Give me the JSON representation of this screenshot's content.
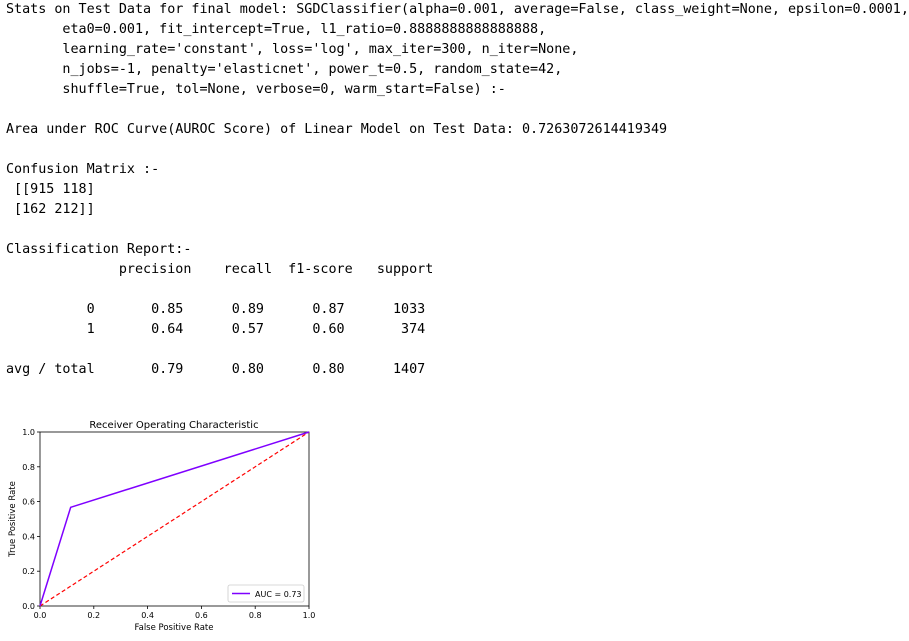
{
  "output_lines": [
    "Stats on Test Data for final model: SGDClassifier(alpha=0.001, average=False, class_weight=None, epsilon=0.0001,",
    "       eta0=0.001, fit_intercept=True, l1_ratio=0.8888888888888888,",
    "       learning_rate='constant', loss='log', max_iter=300, n_iter=None,",
    "       n_jobs=-1, penalty='elasticnet', power_t=0.5, random_state=42,",
    "       shuffle=True, tol=None, verbose=0, warm_start=False) :-",
    "",
    "Area under ROC Curve(AUROC Score) of Linear Model on Test Data: 0.7263072614419349",
    "",
    "Confusion Matrix :-",
    " [[915 118]",
    " [162 212]]",
    "",
    "Classification Report:-",
    "              precision    recall  f1-score   support",
    "",
    "          0       0.85      0.89      0.87      1033",
    "          1       0.64      0.57      0.60       374",
    "",
    "avg / total       0.79      0.80      0.80      1407"
  ],
  "chart_data": {
    "type": "line",
    "title": "Receiver Operating Characteristic",
    "xlabel": "False Positive Rate",
    "ylabel": "True Positive Rate",
    "xlim": [
      0,
      1
    ],
    "ylim": [
      0,
      1
    ],
    "xticks": [
      "0.0",
      "0.2",
      "0.4",
      "0.6",
      "0.8",
      "1.0"
    ],
    "yticks": [
      "0.0",
      "0.2",
      "0.4",
      "0.6",
      "0.8",
      "1.0"
    ],
    "grid": false,
    "legend_position": "lower-right",
    "series": [
      {
        "name": "AUC = 0.73",
        "color": "#7f00ff",
        "style": "solid",
        "x": [
          0.0,
          0.114,
          1.0
        ],
        "y": [
          0.0,
          0.567,
          1.0
        ]
      },
      {
        "color": "#ff0000",
        "style": "dashed",
        "x": [
          0,
          1
        ],
        "y": [
          0,
          1
        ]
      }
    ]
  }
}
